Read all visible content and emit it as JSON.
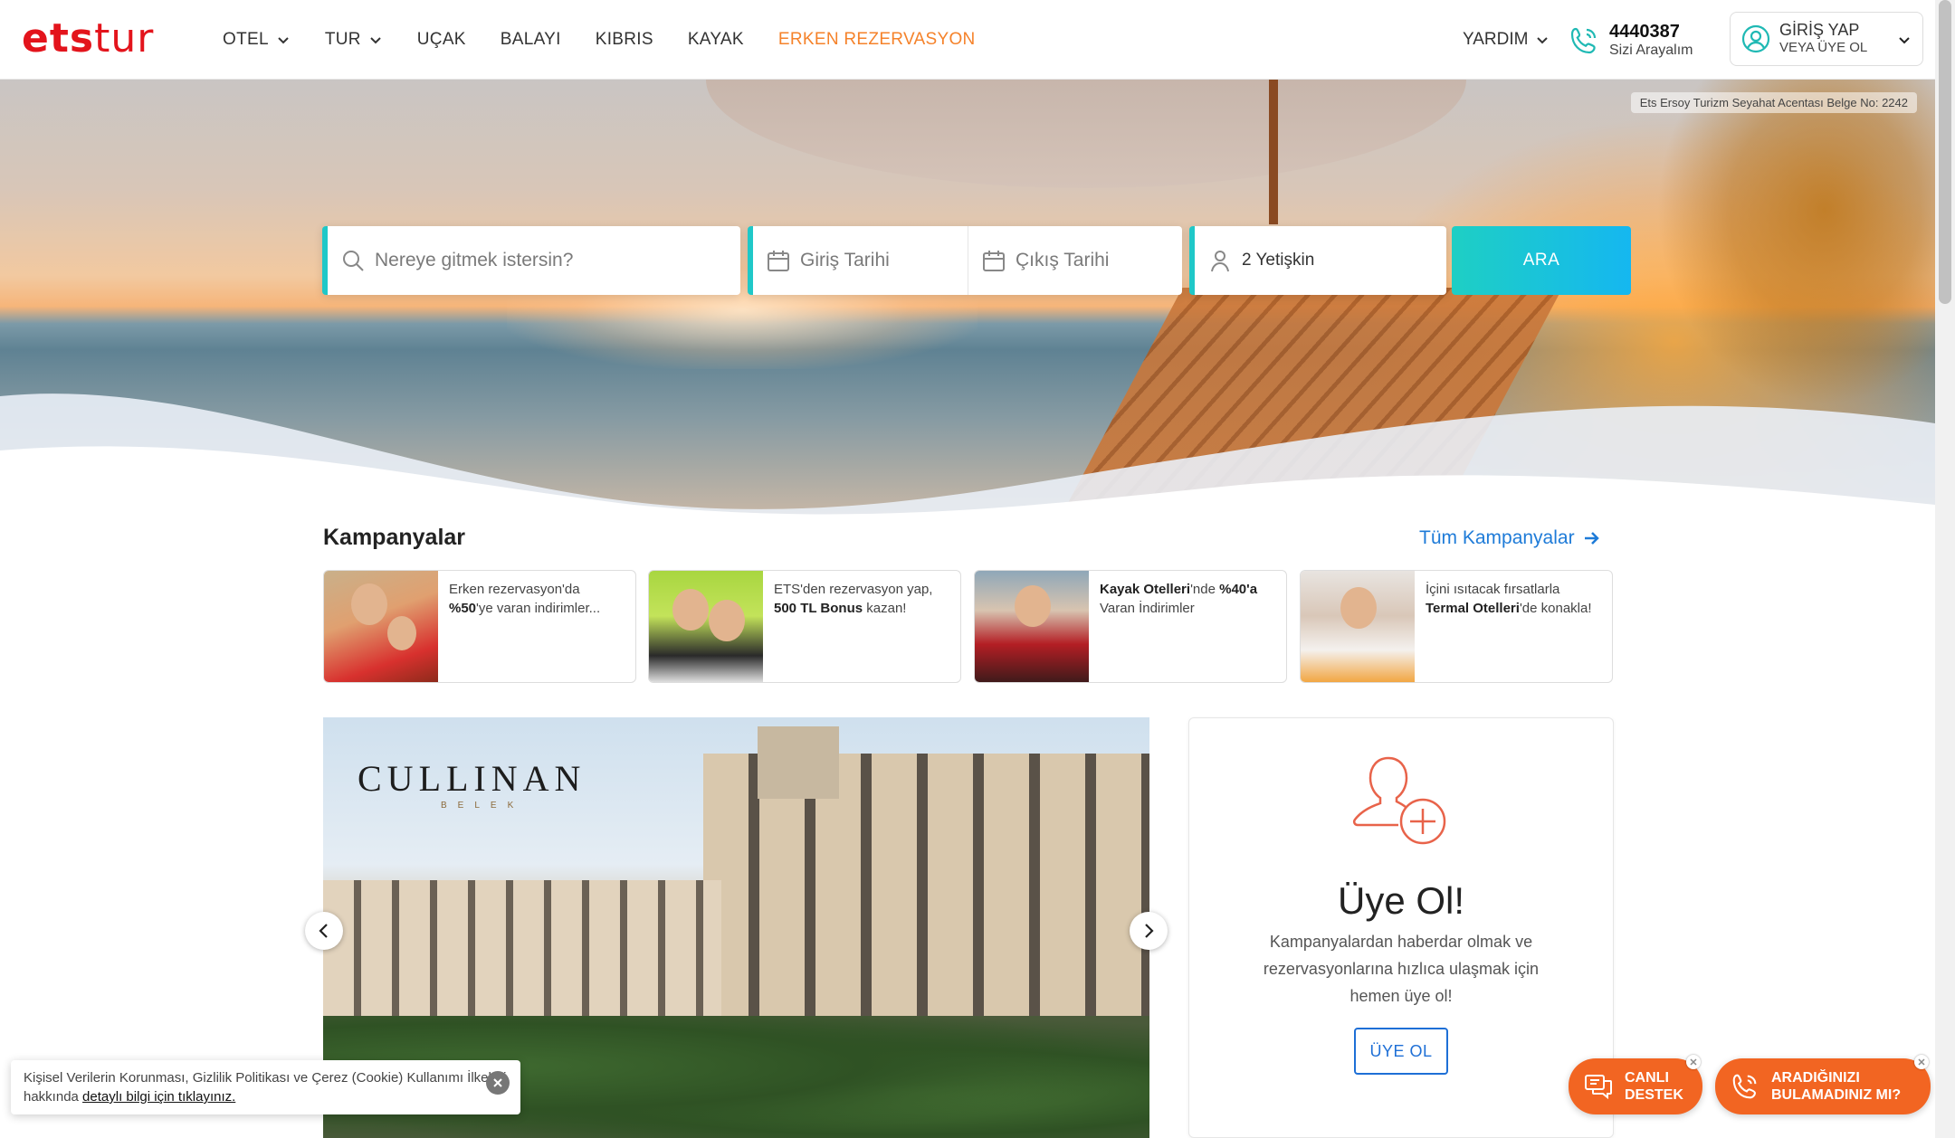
{
  "header": {
    "logo_ets": "ets",
    "logo_tur": "tur",
    "nav": [
      {
        "label": "OTEL",
        "dropdown": true
      },
      {
        "label": "TUR",
        "dropdown": true
      },
      {
        "label": "UÇAK",
        "dropdown": false
      },
      {
        "label": "BALAYI",
        "dropdown": false
      },
      {
        "label": "KIBRIS",
        "dropdown": false
      },
      {
        "label": "KAYAK",
        "dropdown": false
      },
      {
        "label": "ERKEN REZERVASYON",
        "dropdown": false,
        "accent": true
      }
    ],
    "help_label": "YARDIM",
    "phone_number": "4440387",
    "phone_sub": "Sizi Arayalım",
    "login_line1": "GİRİŞ YAP",
    "login_line2": "VEYA ÜYE OL",
    "colors": {
      "brand_red": "#e3141c",
      "accent_orange": "#f5822a",
      "teal": "#1fc8c8"
    }
  },
  "hero": {
    "license": "Ets Ersoy Turizm Seyahat Acentası  Belge No: 2242",
    "search": {
      "destination_placeholder": "Nereye gitmek istersin?",
      "checkin_placeholder": "Giriş Tarihi",
      "checkout_placeholder": "Çıkış Tarihi",
      "guests_value": "2 Yetişkin",
      "submit_label": "ARA"
    }
  },
  "campaigns": {
    "title": "Kampanyalar",
    "all_link": "Tüm Kampanyalar",
    "items": [
      {
        "parts": [
          {
            "t": "Erken rezervasyon'da "
          },
          {
            "t": "%50",
            "b": true
          },
          {
            "t": "'ye varan indirimler..."
          }
        ]
      },
      {
        "parts": [
          {
            "t": "ETS'den rezervasyon yap, "
          },
          {
            "t": "500 TL Bonus",
            "b": true
          },
          {
            "t": " kazan!"
          }
        ]
      },
      {
        "parts": [
          {
            "t": "Kayak Otelleri",
            "b": true
          },
          {
            "t": "'nde "
          },
          {
            "t": "%40'a",
            "b": true
          },
          {
            "t": " Varan İndirimler"
          }
        ]
      },
      {
        "parts": [
          {
            "t": "İçini ısıtacak fırsatlarla "
          },
          {
            "t": "Termal Otelleri",
            "b": true
          },
          {
            "t": "'de konakla!"
          }
        ]
      }
    ]
  },
  "slider": {
    "brand": "CULLINAN",
    "brand_sub": "BELEK"
  },
  "signup": {
    "title": "Üye Ol!",
    "description": "Kampanyalardan haberdar olmak ve rezervasyonlarına hızlıca ulaşmak için hemen üye ol!",
    "button": "ÜYE OL"
  },
  "cookie": {
    "text": "Kişisel Verilerin Korunması, Gizlilik Politikası ve Çerez (Cookie) Kullanımı İlkeleri hakkında ",
    "link": "detaylı bilgi için tıklayınız."
  },
  "floating": {
    "chat_line1": "CANLI",
    "chat_line2": "DESTEK",
    "call_line1": "ARADIĞINIZI",
    "call_line2": "BULAMADINIZ MI?"
  }
}
